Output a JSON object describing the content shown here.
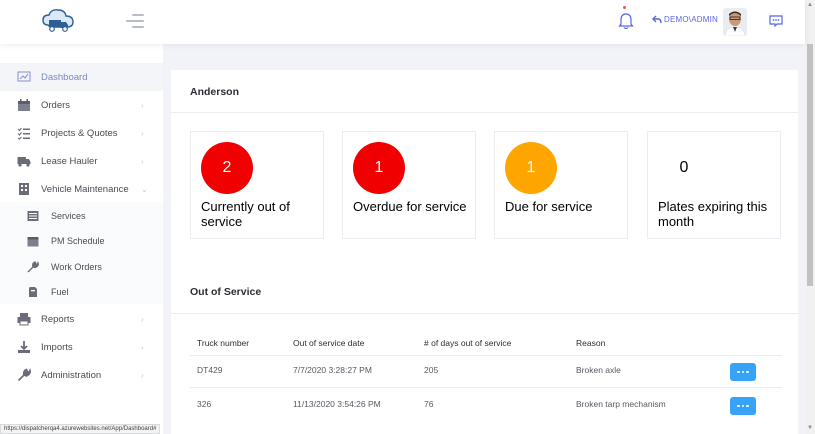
{
  "header": {
    "user_label": "DEMO\\ADMIN",
    "icons": [
      "logo-truck-cloud-icon",
      "hamburger-icon",
      "bell-icon",
      "undo-arrow-icon",
      "chat-icon"
    ]
  },
  "sidebar": {
    "items": [
      {
        "label": "Dashboard",
        "icon": "dashboard-icon",
        "active": true
      },
      {
        "label": "Orders",
        "icon": "calendar-icon",
        "chevron": "›"
      },
      {
        "label": "Projects & Quotes",
        "icon": "checklist-icon",
        "chevron": "›"
      },
      {
        "label": "Lease Hauler",
        "icon": "truck-icon",
        "chevron": "›"
      },
      {
        "label": "Vehicle Maintenance",
        "icon": "building-icon",
        "chevron": "⌄"
      },
      {
        "label": "Reports",
        "icon": "printer-icon",
        "chevron": "›"
      },
      {
        "label": "Imports",
        "icon": "import-icon",
        "chevron": "›"
      },
      {
        "label": "Administration",
        "icon": "wrench-icon",
        "chevron": "›"
      }
    ],
    "subitems": [
      {
        "label": "Services",
        "icon": "list-icon"
      },
      {
        "label": "PM Schedule",
        "icon": "calendar-icon"
      },
      {
        "label": "Work Orders",
        "icon": "wrench-icon"
      },
      {
        "label": "Fuel",
        "icon": "fuel-icon"
      }
    ]
  },
  "main": {
    "title": "Anderson",
    "cards": [
      {
        "value": "2",
        "label": "Currently out of service",
        "color": "#f00000"
      },
      {
        "value": "1",
        "label": "Overdue for service",
        "color": "#f00000"
      },
      {
        "value": "1",
        "label": "Due for service",
        "color": "#ffa500"
      },
      {
        "value": "0",
        "label": "Plates expiring this month",
        "color": ""
      }
    ],
    "section_title": "Out of Service",
    "table": {
      "headers": [
        "Truck number",
        "Out of service date",
        "# of days out of service",
        "Reason"
      ],
      "rows": [
        [
          "DT429",
          "7/7/2020 3:28:27 PM",
          "205",
          "Broken axle"
        ],
        [
          "326",
          "11/13/2020 3:54:26 PM",
          "76",
          "Broken tarp mechanism"
        ]
      ]
    }
  },
  "status_url": "https://dispatcherqa4.azurewebsites.net/App/Dashboard#",
  "colors": {
    "accent": "#5867dd",
    "button": "#36a3f7",
    "danger": "#f00000",
    "warning": "#ffa500"
  }
}
